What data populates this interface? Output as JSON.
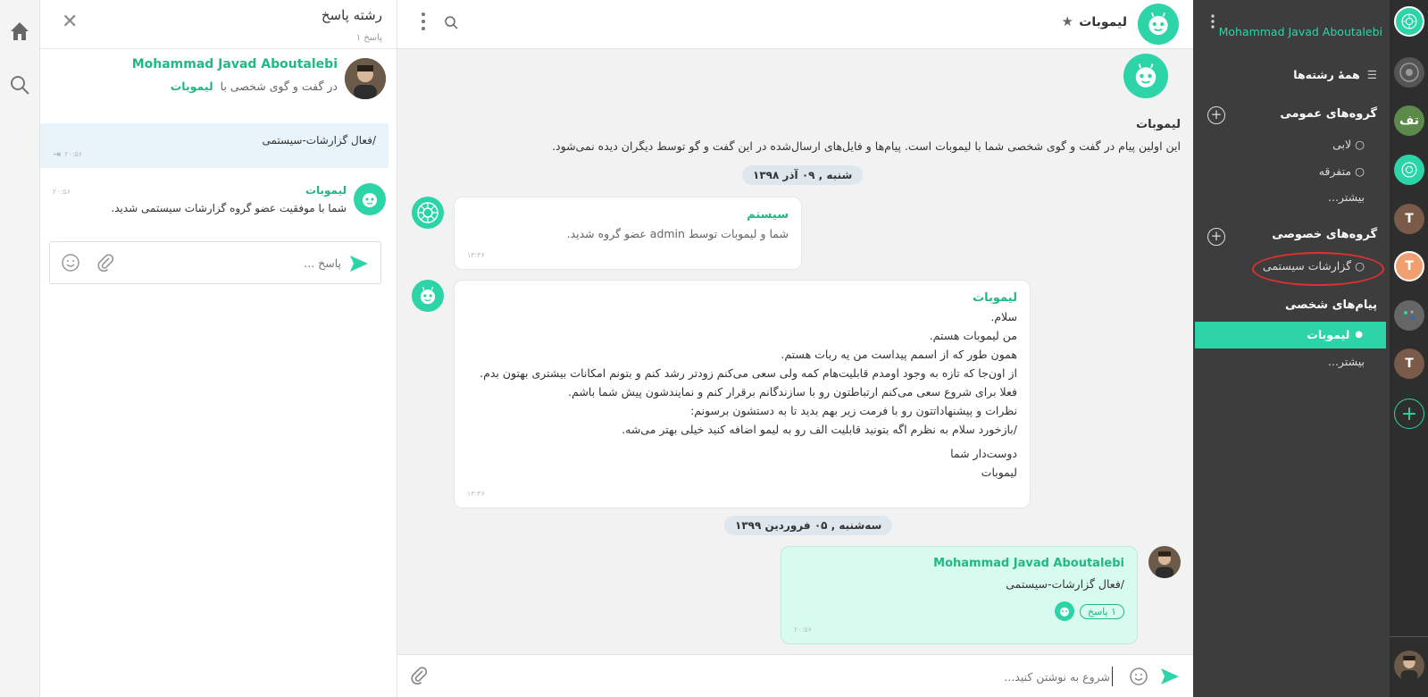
{
  "colors": {
    "accent": "#20b981",
    "sidebar_bg": "#3d3d3d",
    "selected": "#2dd4a8",
    "mine_bubble": "#d8fbef"
  },
  "thread": {
    "title": "رشته پاسخ",
    "count": "۱ پاسخ",
    "user_name": "Mohammad Javad Aboutalebi",
    "context_prefix": "در گفت و گوی شخصی با",
    "context_bot": "لیموبات",
    "command_text": "/فعال گزارشات-سیستمی",
    "command_time": "۲۰:۵۶",
    "reply_sender": "لیموبات",
    "reply_time": "۲۰:۵۶",
    "reply_text": "شما با موفقیت عضو گروه گزارشات سیستمی شدید.",
    "input_placeholder": "پاسخ ..."
  },
  "chat": {
    "title": "لیموبات",
    "intro_name": "لیموبات",
    "intro_text": "این اولین پیام در گفت و گوی شخصی شما با لیموبات است. پیام‌ها و فایل‌های ارسال‌شده در این گفت و گو توسط دیگران دیده نمی‌شود.",
    "date1": "شنبه , ۰۹ آذر ۱۳۹۸",
    "date2": "سه‌شنبه , ۰۵ فروردین ۱۳۹۹",
    "system_sender": "سیستم",
    "system_text": "شما و لیموبات توسط admin عضو گروه شدید.",
    "system_time": "۱۳:۳۶",
    "bot_sender": "لیموبات",
    "bot_lines": [
      "سلام.",
      "من لیموبات هستم.",
      "همون طور که از اسمم پیداست من یه ربات هستم.",
      "از اون‌جا که تازه به وجود اومدم قابلیت‌هام کمه ولی سعی می‌کنم زودتر رشد کنم و بتونم امکانات بیشتری بهتون بدم.",
      "فعلا برای شروع سعی می‌کنم ارتباطتون رو با سازندگانم برقرار کنم و نمایندشون پیش شما باشم.",
      "نظرات و پیشنهاداتتون رو با فرمت زیر بهم بدید تا به دستشون برسونم:",
      "/بازخورد سلام به نظرم اگه بتونید قابلیت الف رو به لیمو اضافه کنید خیلی بهتر می‌شه."
    ],
    "bot_sign1": "دوست‌دار شما",
    "bot_sign2": "لیموبات",
    "bot_time": "۱۳:۳۶",
    "my_name": "Mohammad Javad Aboutalebi",
    "my_text": "/فعال گزارشات-سیستمی",
    "my_replies": "۱ پاسخ",
    "my_time": "۲۰:۵۶",
    "input_placeholder": "شروع به نوشتن کنید..."
  },
  "sidebar": {
    "user_name": "Mohammad Javad Aboutalebi",
    "all_threads": "همهٔ رشته‌ها",
    "public_heading": "گروه‌های عمومی",
    "public_items": [
      "لابی",
      "متفرقه"
    ],
    "more1": "بیشتر...",
    "private_heading": "گروه‌های خصوصی",
    "private_items": [
      "گزارشات سیستمی"
    ],
    "dm_heading": "پیام‌های شخصی",
    "dm_selected": "لیموبات",
    "more2": "بیشتر..."
  },
  "rail": {
    "avatars": [
      "تف",
      "T",
      "T",
      "T"
    ]
  }
}
